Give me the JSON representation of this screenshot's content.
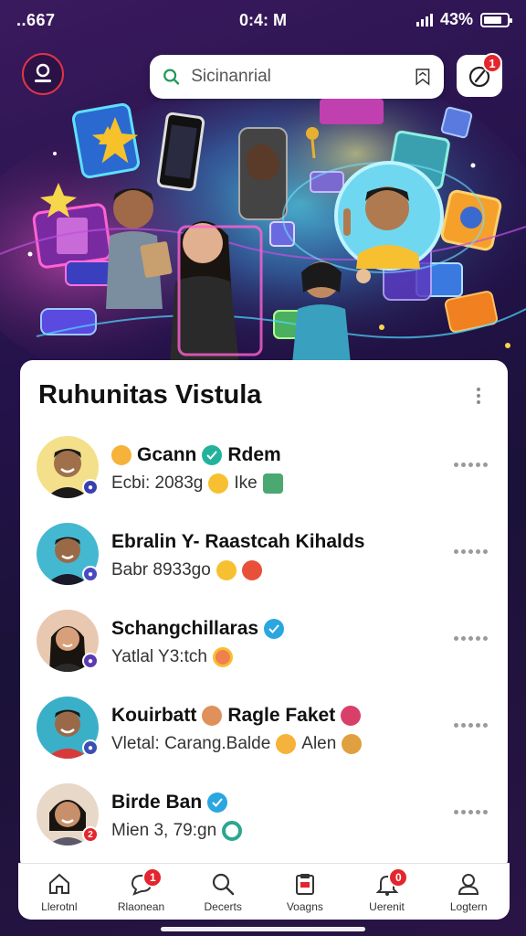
{
  "status_bar": {
    "carrier": "..667",
    "time": "0:4: M",
    "battery": "43%",
    "battery_level": 0.8
  },
  "header": {
    "search_placeholder": "Sicinanrial",
    "notification_count": "1",
    "icons": {
      "profile": "profile-icon",
      "search": "search-icon",
      "bookmark": "bookmark-icon",
      "notification": "notification-icon"
    }
  },
  "colors": {
    "accent": "#e3262e",
    "verified": "#2aa6e0",
    "background_top": "#3a1a5e",
    "card": "#ffffff"
  },
  "card": {
    "title": "Ruhunitas Vistula",
    "contacts": [
      {
        "name": "Gcann",
        "name2": "Rdem",
        "sub": "Ecbi: 2083g",
        "sub2": "Ike",
        "presence": "#3a3fb0"
      },
      {
        "name": "Ebralin  Y- Raastcah  Kihalds",
        "name2": "",
        "sub": "Babr 8933go",
        "sub2": "",
        "presence": "#4a4ac0"
      },
      {
        "name": "Schangchillaras",
        "name2": "",
        "sub": "Yatlal Y3:tch",
        "sub2": "",
        "presence": "#5a3ab0"
      },
      {
        "name": "Kouirbatt",
        "name2": "Ragle Faket",
        "sub": "Vletal: Carang.Balde",
        "sub2": "Alen",
        "presence": "#3a4fb0"
      },
      {
        "name": "Birde Ban",
        "name2": "",
        "sub": "Mien 3, 79:gn",
        "sub2": "",
        "presence": "#e3262e",
        "presence_label": "2"
      }
    ]
  },
  "nav": {
    "items": [
      {
        "label": "Llerotnl",
        "icon": "home-icon",
        "badge": ""
      },
      {
        "label": "Rlaonean",
        "icon": "chat-icon",
        "badge": "1"
      },
      {
        "label": "Decerts",
        "icon": "search-icon",
        "badge": ""
      },
      {
        "label": "Voagns",
        "icon": "clipboard-icon",
        "badge": ""
      },
      {
        "label": "Uerenit",
        "icon": "bell-icon",
        "badge": "0"
      },
      {
        "label": "Logtern",
        "icon": "user-icon",
        "badge": ""
      }
    ]
  }
}
